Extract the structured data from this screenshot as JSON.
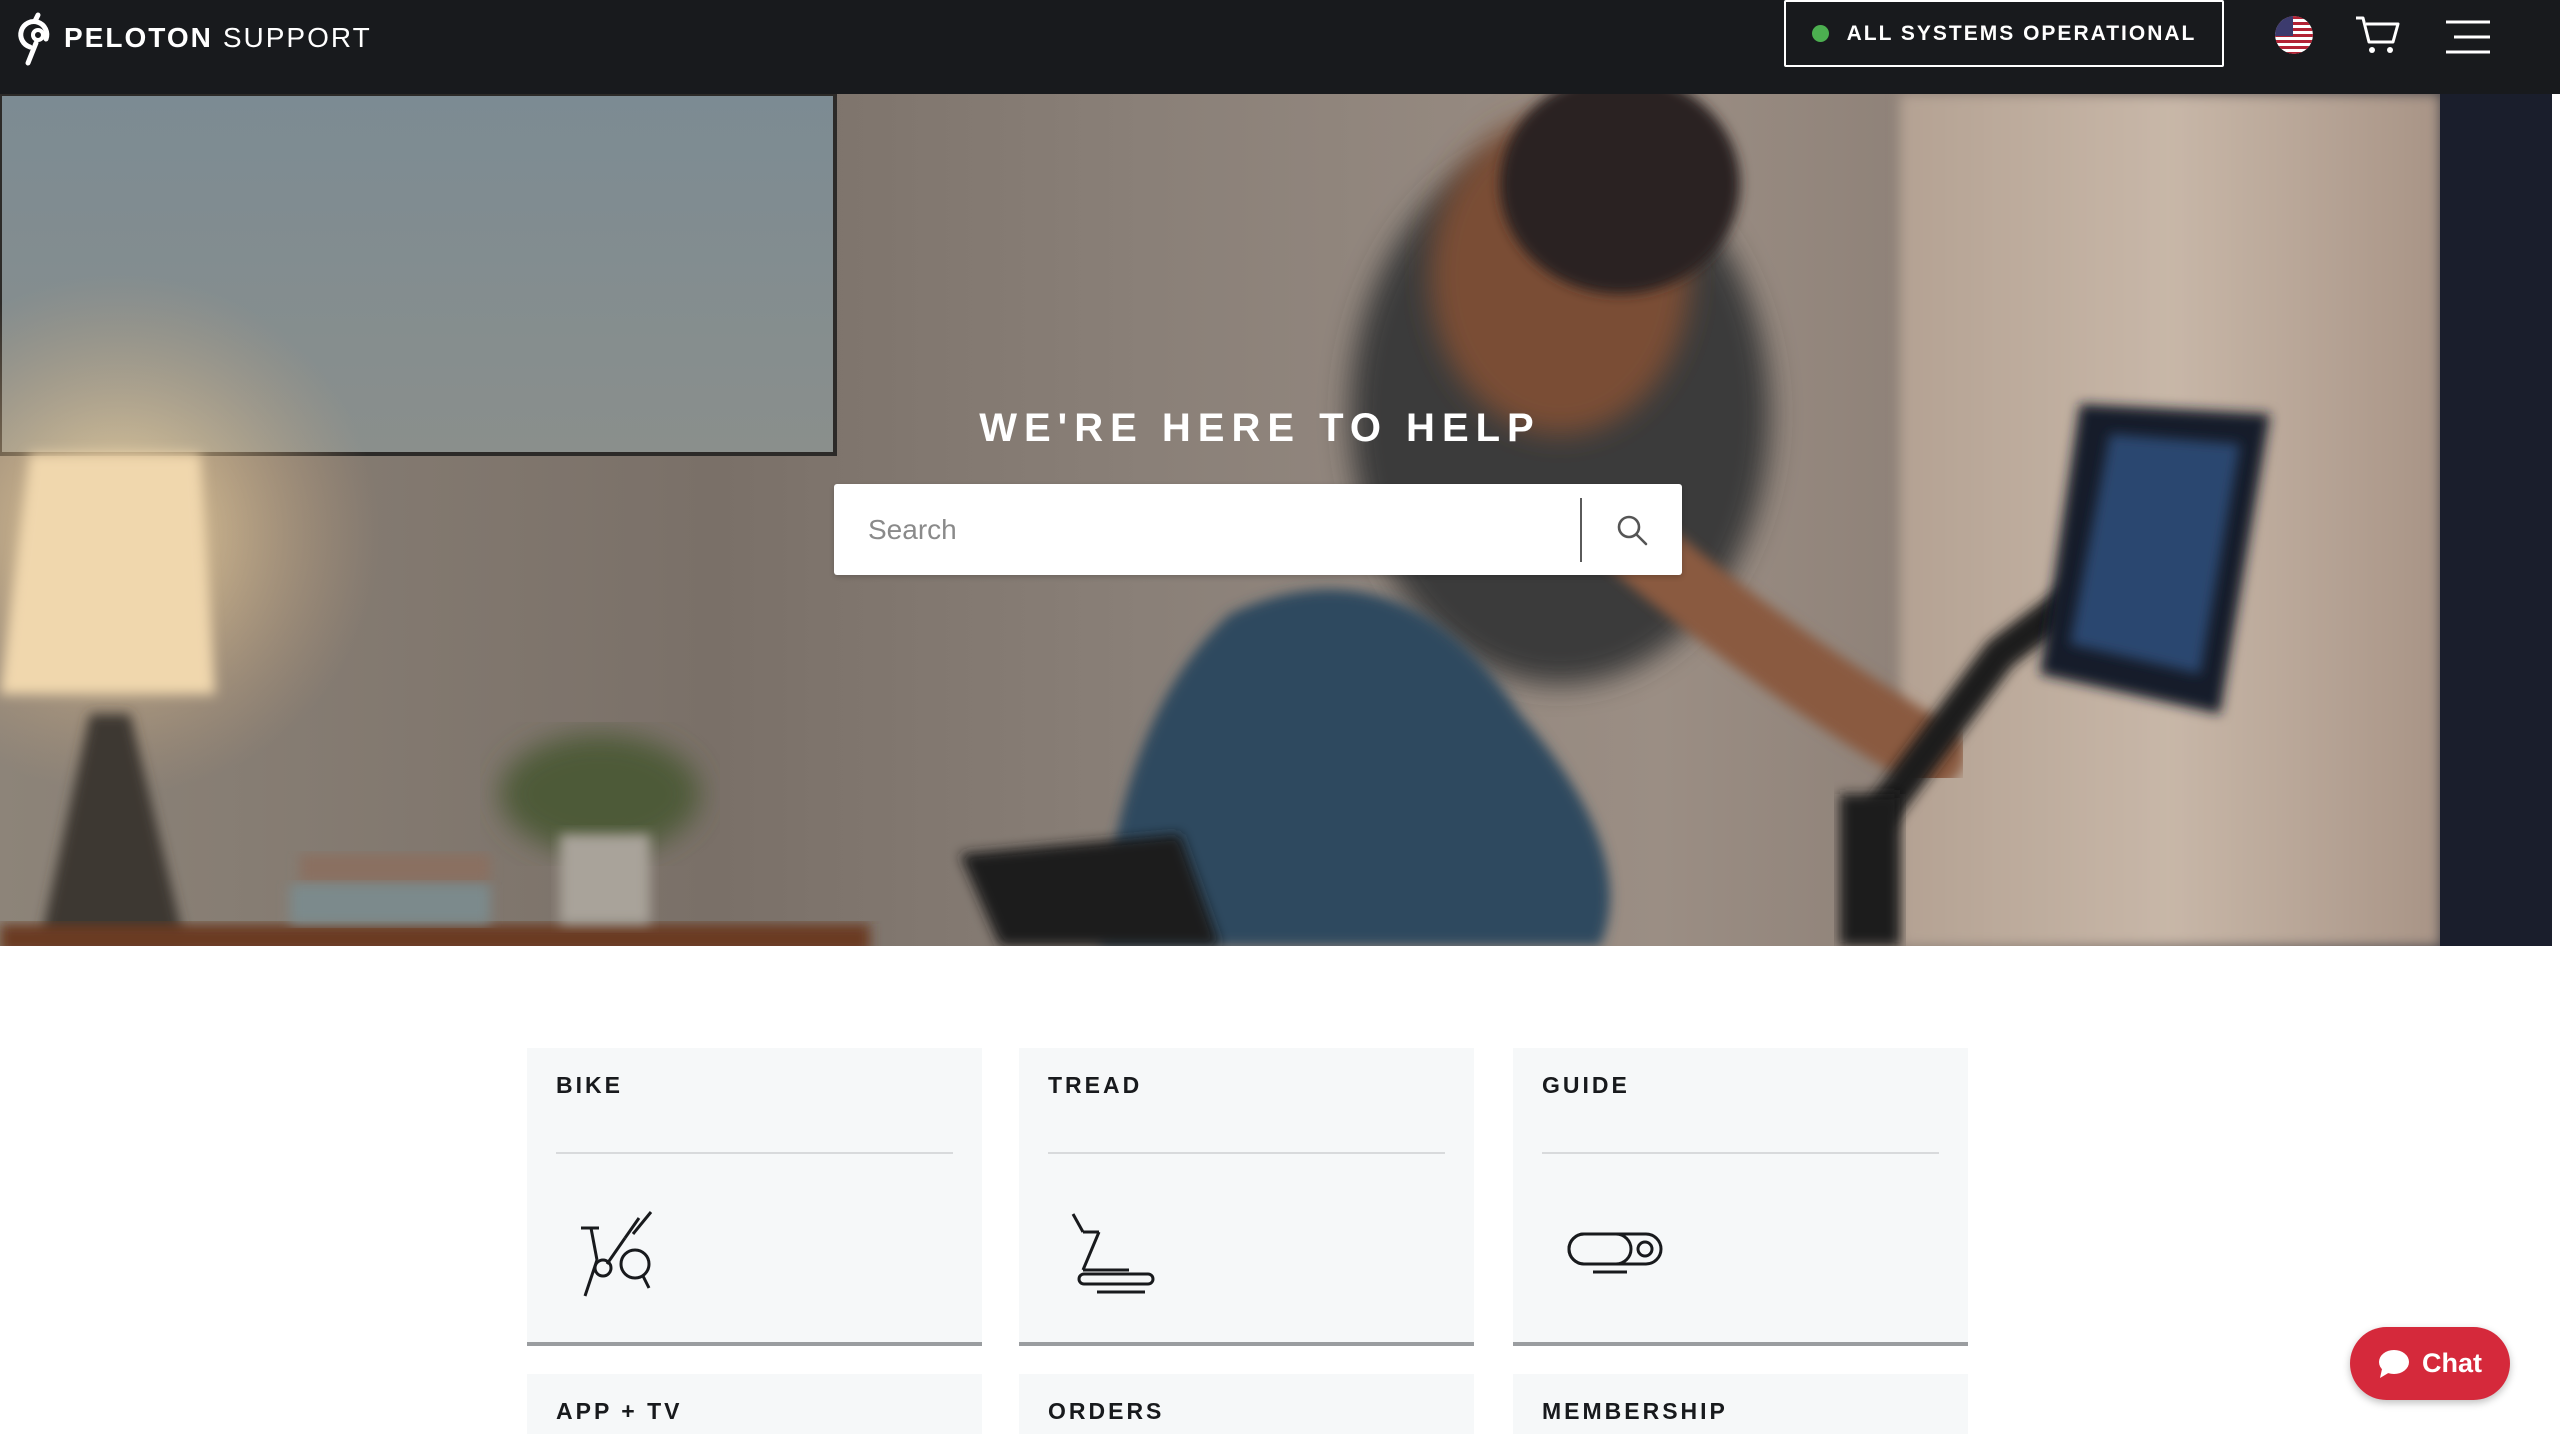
{
  "header": {
    "brand_name": "PELOTON",
    "brand_sub": "SUPPORT",
    "status_label": "ALL SYSTEMS OPERATIONAL",
    "status_color": "#4caf50",
    "flag_icon": "us-flag-icon",
    "cart_icon": "cart-icon",
    "menu_icon": "hamburger-menu-icon"
  },
  "hero": {
    "title": "WE'RE HERE TO HELP",
    "search_placeholder": "Search",
    "search_icon": "search-icon"
  },
  "categories": [
    {
      "label": "BIKE",
      "icon": "bike-icon"
    },
    {
      "label": "TREAD",
      "icon": "treadmill-icon"
    },
    {
      "label": "GUIDE",
      "icon": "guide-camera-icon"
    },
    {
      "label": "APP + TV"
    },
    {
      "label": "ORDERS"
    },
    {
      "label": "MEMBERSHIP"
    }
  ],
  "chat": {
    "label": "Chat",
    "color": "#d5293b",
    "icon": "chat-bubble-icon"
  }
}
